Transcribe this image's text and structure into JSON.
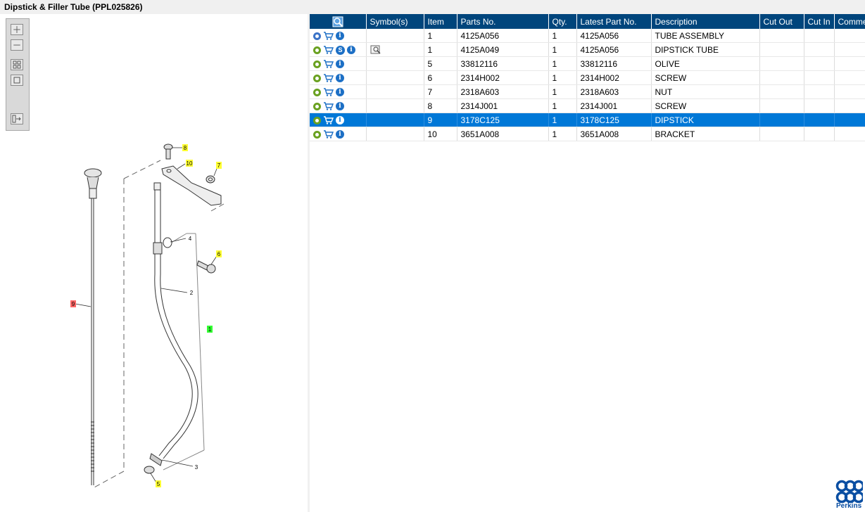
{
  "window": {
    "title": "Dipstick & Filler Tube (PPL025826)"
  },
  "toolbox": {
    "buttons": [
      {
        "name": "zoom-in-button",
        "icon": "plus-icon"
      },
      {
        "name": "zoom-out-button",
        "icon": "minus-icon"
      },
      {
        "name": "fit-all-button",
        "icon": "grid-icon"
      },
      {
        "name": "fit-window-button",
        "icon": "square-icon"
      },
      {
        "name": "toggle-list-button",
        "icon": "list-arrow-icon"
      }
    ]
  },
  "drawing": {
    "callouts": [
      "8",
      "10",
      "7",
      "4",
      "6",
      "2",
      "9",
      "1",
      "3",
      "5"
    ]
  },
  "table": {
    "headers": {
      "actions": "",
      "symbols": "Symbol(s)",
      "item": "Item",
      "parts_no": "Parts No.",
      "qty": "Qty.",
      "latest": "Latest Part No.",
      "description": "Description",
      "cut_out": "Cut Out",
      "cut_in": "Cut In",
      "comment": "Comment"
    },
    "rows": [
      {
        "item": "1",
        "parts_no": "4125A056",
        "qty": "1",
        "latest": "4125A056",
        "description": "TUBE ASSEMBLY",
        "cut_out": "",
        "cut_in": "",
        "comment": ""
      },
      {
        "item": "1",
        "parts_no": "4125A049",
        "qty": "1",
        "latest": "4125A056",
        "description": "DIPSTICK TUBE",
        "cut_out": "",
        "cut_in": "",
        "comment": ""
      },
      {
        "item": "5",
        "parts_no": "33812116",
        "qty": "1",
        "latest": "33812116",
        "description": "OLIVE",
        "cut_out": "",
        "cut_in": "",
        "comment": ""
      },
      {
        "item": "6",
        "parts_no": "2314H002",
        "qty": "1",
        "latest": "2314H002",
        "description": "SCREW",
        "cut_out": "",
        "cut_in": "",
        "comment": ""
      },
      {
        "item": "7",
        "parts_no": "2318A603",
        "qty": "1",
        "latest": "2318A603",
        "description": "NUT",
        "cut_out": "",
        "cut_in": "",
        "comment": ""
      },
      {
        "item": "8",
        "parts_no": "2314J001",
        "qty": "1",
        "latest": "2314J001",
        "description": "SCREW",
        "cut_out": "",
        "cut_in": "",
        "comment": ""
      },
      {
        "item": "9",
        "parts_no": "3178C125",
        "qty": "1",
        "latest": "3178C125",
        "description": "DIPSTICK",
        "cut_out": "",
        "cut_in": "",
        "comment": ""
      },
      {
        "item": "10",
        "parts_no": "3651A008",
        "qty": "1",
        "latest": "3651A008",
        "description": "BRACKET",
        "cut_out": "",
        "cut_in": "",
        "comment": ""
      }
    ]
  },
  "brand": {
    "name": "Perkins",
    "color": "#0a4ea2"
  },
  "colors": {
    "header": "#00457c",
    "selected": "#0078d7",
    "callout_yellow": "#ffff33",
    "callout_red": "#ff6666",
    "callout_green": "#33ff33"
  }
}
